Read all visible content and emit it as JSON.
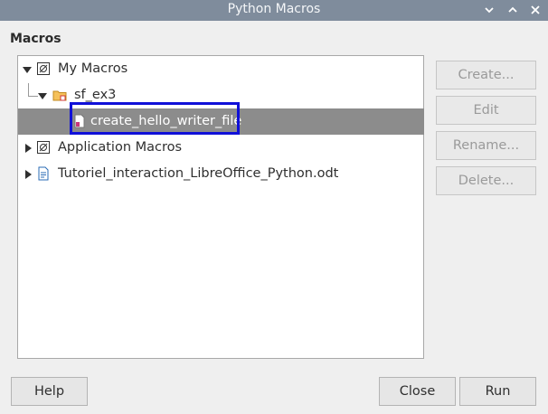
{
  "window": {
    "title": "Python Macros",
    "controls": [
      "chevron-down-icon",
      "chevron-up-icon",
      "close-icon"
    ]
  },
  "section_label": "Macros",
  "tree": {
    "items": [
      {
        "label": "My Macros",
        "expanded": true,
        "icon": "library-icon",
        "level": 0
      },
      {
        "label": "sf_ex3",
        "expanded": true,
        "icon": "folder-icon",
        "level": 1
      },
      {
        "label": "create_hello_writer_file",
        "selected": true,
        "icon": "macro-file-icon",
        "level": 2
      },
      {
        "label": "Application Macros",
        "expanded": false,
        "icon": "library-icon",
        "level": 0
      },
      {
        "label": "Tutoriel_interaction_LibreOffice_Python.odt",
        "expanded": false,
        "icon": "document-icon",
        "level": 0
      }
    ]
  },
  "side_buttons": {
    "create": "Create...",
    "edit": "Edit",
    "rename": "Rename...",
    "delete": "Delete..."
  },
  "footer": {
    "help": "Help",
    "close": "Close",
    "run": "Run"
  },
  "colors": {
    "titlebar": "#7f8c9c",
    "selection": "#8c8c8c",
    "highlight_box": "#1010d8"
  }
}
